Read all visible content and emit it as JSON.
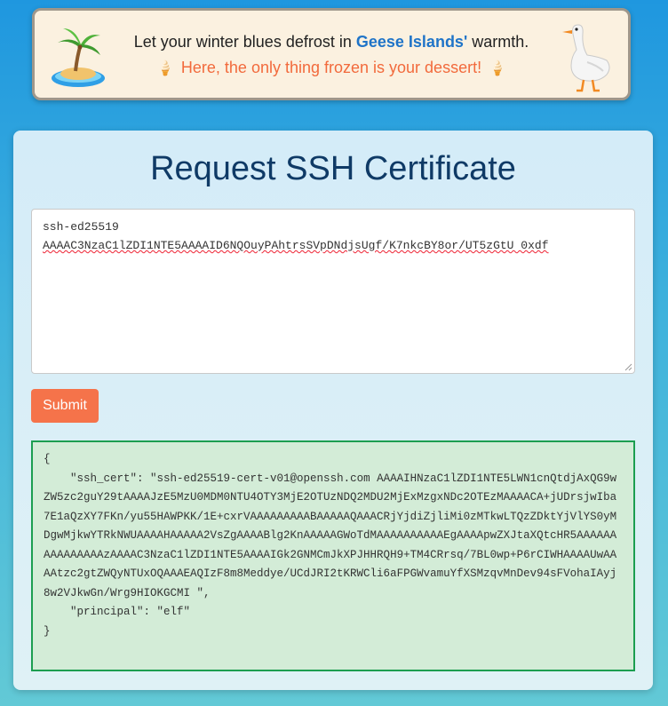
{
  "banner": {
    "line1_prefix": "Let your winter blues defrost in ",
    "line1_highlight": "Geese Islands'",
    "line1_suffix": " warmth.",
    "line2": "Here, the only thing frozen is your dessert!"
  },
  "page": {
    "title": "Request SSH Certificate"
  },
  "key_input": {
    "line1": "ssh-ed25519",
    "line2": "AAAAC3NzaC1lZDI1NTE5AAAAID6NQOuyPAhtrsSVpDNdjsUgf/K7nkcBY8or/UT5zGtU 0xdf"
  },
  "submit": {
    "label": "Submit"
  },
  "result": {
    "text": "{\n    \"ssh_cert\": \"ssh-ed25519-cert-v01@openssh.com AAAAIHNzaC1lZDI1NTE5LWN1cnQtdjAxQG9wZW5zc2guY29tAAAAJzE5MzU0MDM0NTU4OTY3MjE2OTUzNDQ2MDU2MjExMzgxNDc2OTEzMAAAACA+jUDrsjwIba7E1aQzXY7FKn/yu55HAWPKK/1E+cxrVAAAAAAAAABAAAAAQAAACRjYjdiZjliMi0zMTkwLTQzZDktYjVlYS0yMDgwMjkwYTRkNWUAAAAHAAAAA2VsZgAAAABlg2KnAAAAAGWoTdMAAAAAAAAAAEgAAAApwZXJtaXQtcHR5AAAAAAAAAAAAAAAzAAAAC3NzaC1lZDI1NTE5AAAAIGk2GNMCmJkXPJHHRQH9+TM4CRrsq/7BL0wp+P6rCIWHAAAAUwAAAAtzc2gtZWQyNTUxOQAAAEAQIzF8m8Meddye/UCdJRI2tKRWCli6aFPGWvamuYfXSMzqvMnDev94sFVohaIAyj8w2VJkwGn/Wrg9HIOKGCMI \",\n    \"principal\": \"elf\"\n}"
  }
}
